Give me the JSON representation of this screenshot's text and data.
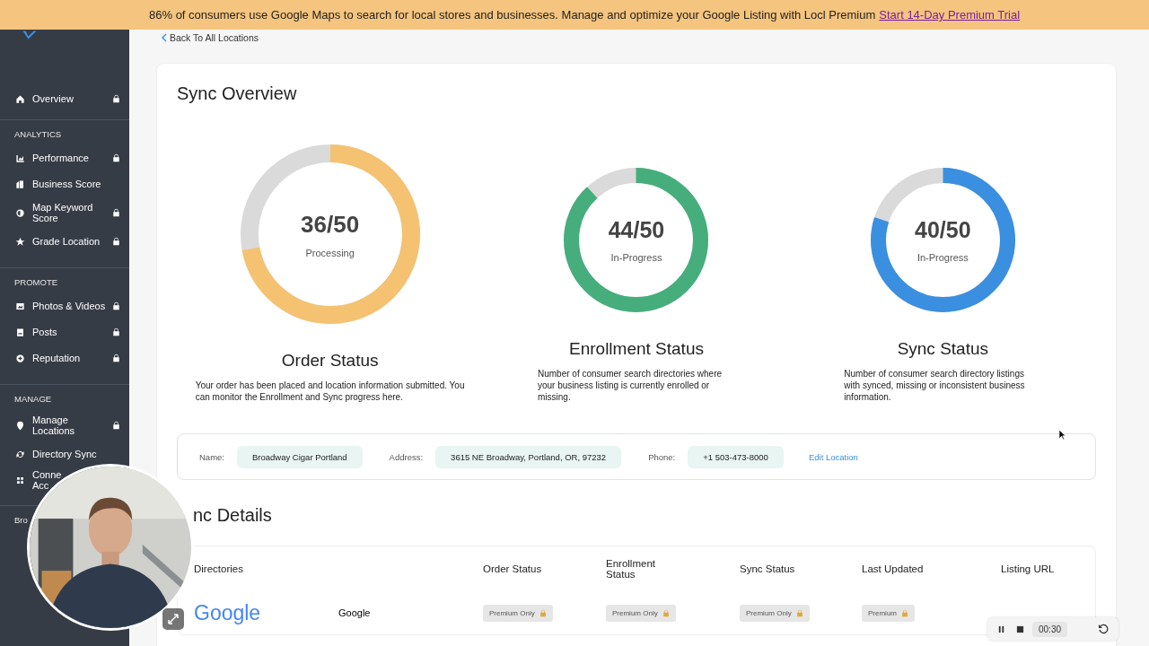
{
  "banner": {
    "text": "86% of consumers use Google Maps to search for local stores and businesses. Manage and optimize your Google Listing with Locl Premium",
    "link": "Start 14-Day Premium Trial"
  },
  "sidebar": {
    "sections": [
      {
        "items": [
          {
            "label": "Overview",
            "locked": true
          }
        ]
      },
      {
        "header": "ANALYTICS",
        "items": [
          {
            "label": "Performance",
            "locked": true
          },
          {
            "label": "Business Score",
            "locked": false
          },
          {
            "label": "Map Keyword Score",
            "locked": true
          },
          {
            "label": "Grade Location",
            "locked": true
          }
        ]
      },
      {
        "header": "PROMOTE",
        "items": [
          {
            "label": "Photos & Videos",
            "locked": true
          },
          {
            "label": "Posts",
            "locked": true
          },
          {
            "label": "Reputation",
            "locked": true
          }
        ]
      },
      {
        "header": "MANAGE",
        "items": [
          {
            "label": "Manage Locations",
            "locked": true
          },
          {
            "label": "Directory Sync",
            "locked": false
          },
          {
            "label": "Conne Acc",
            "locked": false
          }
        ]
      },
      {
        "header": "Bro"
      }
    ]
  },
  "back_link": "Back To All Locations",
  "overview": {
    "title": "Sync Overview",
    "statuses": [
      {
        "kind": "large",
        "count": "36/50",
        "state": "Processing",
        "color": "#f5c272",
        "title": "Order Status",
        "description": "Your order has been placed and location information submitted. You can monitor the Enrollment and Sync progress here."
      },
      {
        "kind": "regular",
        "count": "44/50",
        "state": "In-Progress",
        "color": "#45ae7c",
        "title": "Enrollment Status",
        "description": "Number of consumer search directories where your business listing is currently enrolled or missing."
      },
      {
        "kind": "regular",
        "count": "40/50",
        "state": "In-Progress",
        "color": "#3b8fe0",
        "title": "Sync Status",
        "description": "Number of consumer search directory listings with synced, missing or inconsistent business information."
      }
    ]
  },
  "location": {
    "fields": [
      {
        "label": "Name:",
        "value": "Broadway Cigar Portland"
      },
      {
        "label": "Address:",
        "value": "3615 NE Broadway, Portland, OR, 97232"
      },
      {
        "label": "Phone:",
        "value": "+1 503-473-8000"
      }
    ],
    "edit_link": "Edit Location"
  },
  "details": {
    "title": "nc Details",
    "columns": [
      "Directories",
      "",
      "Order Status",
      "Enrollment Status",
      "Sync Status",
      "Last Updated",
      "Listing URL"
    ],
    "rows": [
      {
        "cells": [
          "Google",
          "Google",
          "Premium Only",
          "Premium Only",
          "Premium Only",
          "Premium"
        ]
      }
    ]
  },
  "player": {
    "time": "00:30"
  }
}
